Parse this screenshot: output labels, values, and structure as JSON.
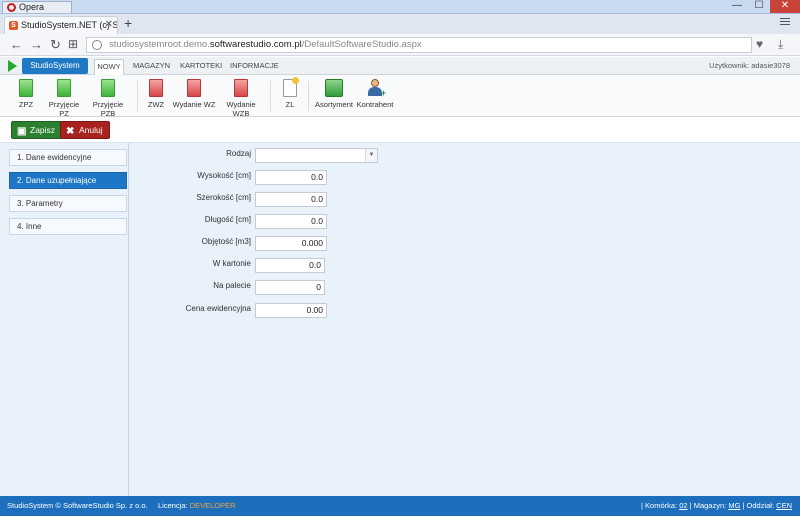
{
  "os": {
    "tab_label": "Opera",
    "min": "—",
    "max": "☐",
    "close": "✕"
  },
  "browser": {
    "tab_title": "StudioSystem.NET (c) Soft",
    "tab_close": "✕",
    "new_tab": "+",
    "url_prefix": "studiosystemroot.demo.",
    "url_domain": "softwarestudio.com.pl",
    "url_path": "/DefaultSoftwareStudio.aspx"
  },
  "app": {
    "brand": "StudioSystem",
    "menu_tabs": [
      "NOWY",
      "MAGAZYN",
      "KARTOTEKI",
      "INFORMACJE"
    ],
    "user_label": "Użytkownik: adasie3078"
  },
  "ribbon": [
    {
      "label": "ZPZ"
    },
    {
      "label": "Przyjęcie PZ"
    },
    {
      "label": "Przyjęcie PZB"
    },
    {
      "label": "ZWZ"
    },
    {
      "label": "Wydanie WZ"
    },
    {
      "label": "Wydanie WZB"
    },
    {
      "label": "ZL"
    },
    {
      "label": "Asortyment"
    },
    {
      "label": "Kontrahent"
    }
  ],
  "actions": {
    "save": "Zapisz",
    "cancel": "Anuluj"
  },
  "sidebar": [
    {
      "label": "1. Dane ewidencyjne"
    },
    {
      "label": "2. Dane uzupełniające"
    },
    {
      "label": "3. Parametry"
    },
    {
      "label": "4. Inne"
    }
  ],
  "form": {
    "rodzaj": {
      "label": "Rodzaj",
      "value": ""
    },
    "wysokosc": {
      "label": "Wysokość [cm]",
      "value": "0.0"
    },
    "szerokosc": {
      "label": "Szerokość [cm]",
      "value": "0.0"
    },
    "dlugosc": {
      "label": "Długość [cm]",
      "value": "0.0"
    },
    "objetosc": {
      "label": "Objętość [m3]",
      "value": "0.000"
    },
    "w_kartonie": {
      "label": "W kartonie",
      "value": "0.0"
    },
    "na_palecie": {
      "label": "Na palecie",
      "value": "0"
    },
    "cena": {
      "label": "Cena ewidencyjna",
      "value": "0.00"
    }
  },
  "status": {
    "copyright": "StudioSystem © SoftwareStudio Sp. z o.o.",
    "license_label": "Licencja:",
    "license_value": "DEVELOPER",
    "komorka_label": "| Komórka:",
    "komorka_value": "02",
    "magazyn_label": "| Magazyn:",
    "magazyn_value": "MG",
    "oddzial_label": "| Oddział:",
    "oddzial_value": "CEN"
  }
}
